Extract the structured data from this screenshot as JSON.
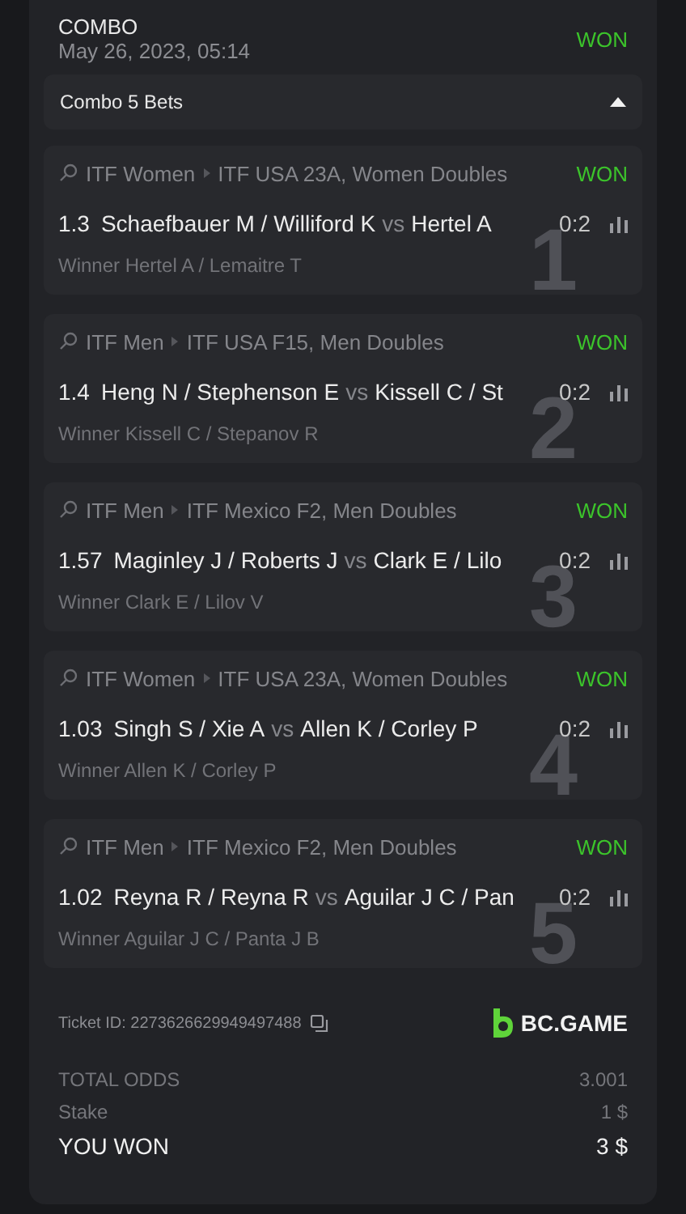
{
  "header": {
    "title": "COMBO",
    "date": "May 26, 2023, 05:14",
    "status": "WON"
  },
  "combo": {
    "label": "Combo 5 Bets",
    "expanded": true
  },
  "bets": [
    {
      "index": "1",
      "sport": "ITF Women",
      "tournament": "ITF USA 23A, Women Doubles",
      "status": "WON",
      "odds": "1.3",
      "home": "Schaefbauer M / Williford K",
      "vs": "vs",
      "away": "Hertel A",
      "score": "0:2",
      "pick": "Winner Hertel A / Lemaitre T"
    },
    {
      "index": "2",
      "sport": "ITF Men",
      "tournament": "ITF USA F15, Men Doubles",
      "status": "WON",
      "odds": "1.4",
      "home": "Heng N / Stephenson E",
      "vs": "vs",
      "away": "Kissell C / St",
      "score": "0:2",
      "pick": "Winner Kissell C / Stepanov R"
    },
    {
      "index": "3",
      "sport": "ITF Men",
      "tournament": "ITF Mexico F2, Men Doubles",
      "status": "WON",
      "odds": "1.57",
      "home": "Maginley J / Roberts J",
      "vs": "vs",
      "away": "Clark E / Lilo",
      "score": "0:2",
      "pick": "Winner Clark E / Lilov V"
    },
    {
      "index": "4",
      "sport": "ITF Women",
      "tournament": "ITF USA 23A, Women Doubles",
      "status": "WON",
      "odds": "1.03",
      "home": "Singh S / Xie A",
      "vs": "vs",
      "away": "Allen K / Corley P",
      "score": "0:2",
      "pick": "Winner Allen K / Corley P"
    },
    {
      "index": "5",
      "sport": "ITF Men",
      "tournament": "ITF Mexico F2, Men Doubles",
      "status": "WON",
      "odds": "1.02",
      "home": "Reyna R / Reyna R",
      "vs": "vs",
      "away": "Aguilar J C / Pan",
      "score": "0:2",
      "pick": "Winner Aguilar J C / Panta J B"
    }
  ],
  "ticket": {
    "id": "Ticket ID: 2273626629949497488",
    "brand": "BC.GAME"
  },
  "totals": [
    {
      "kind": "plain",
      "label": "TOTAL ODDS",
      "value": "3.001"
    },
    {
      "kind": "plain",
      "label": "Stake",
      "value": "1 $"
    },
    {
      "kind": "emphasis",
      "label": "YOU WON",
      "value": "3 $"
    }
  ]
}
